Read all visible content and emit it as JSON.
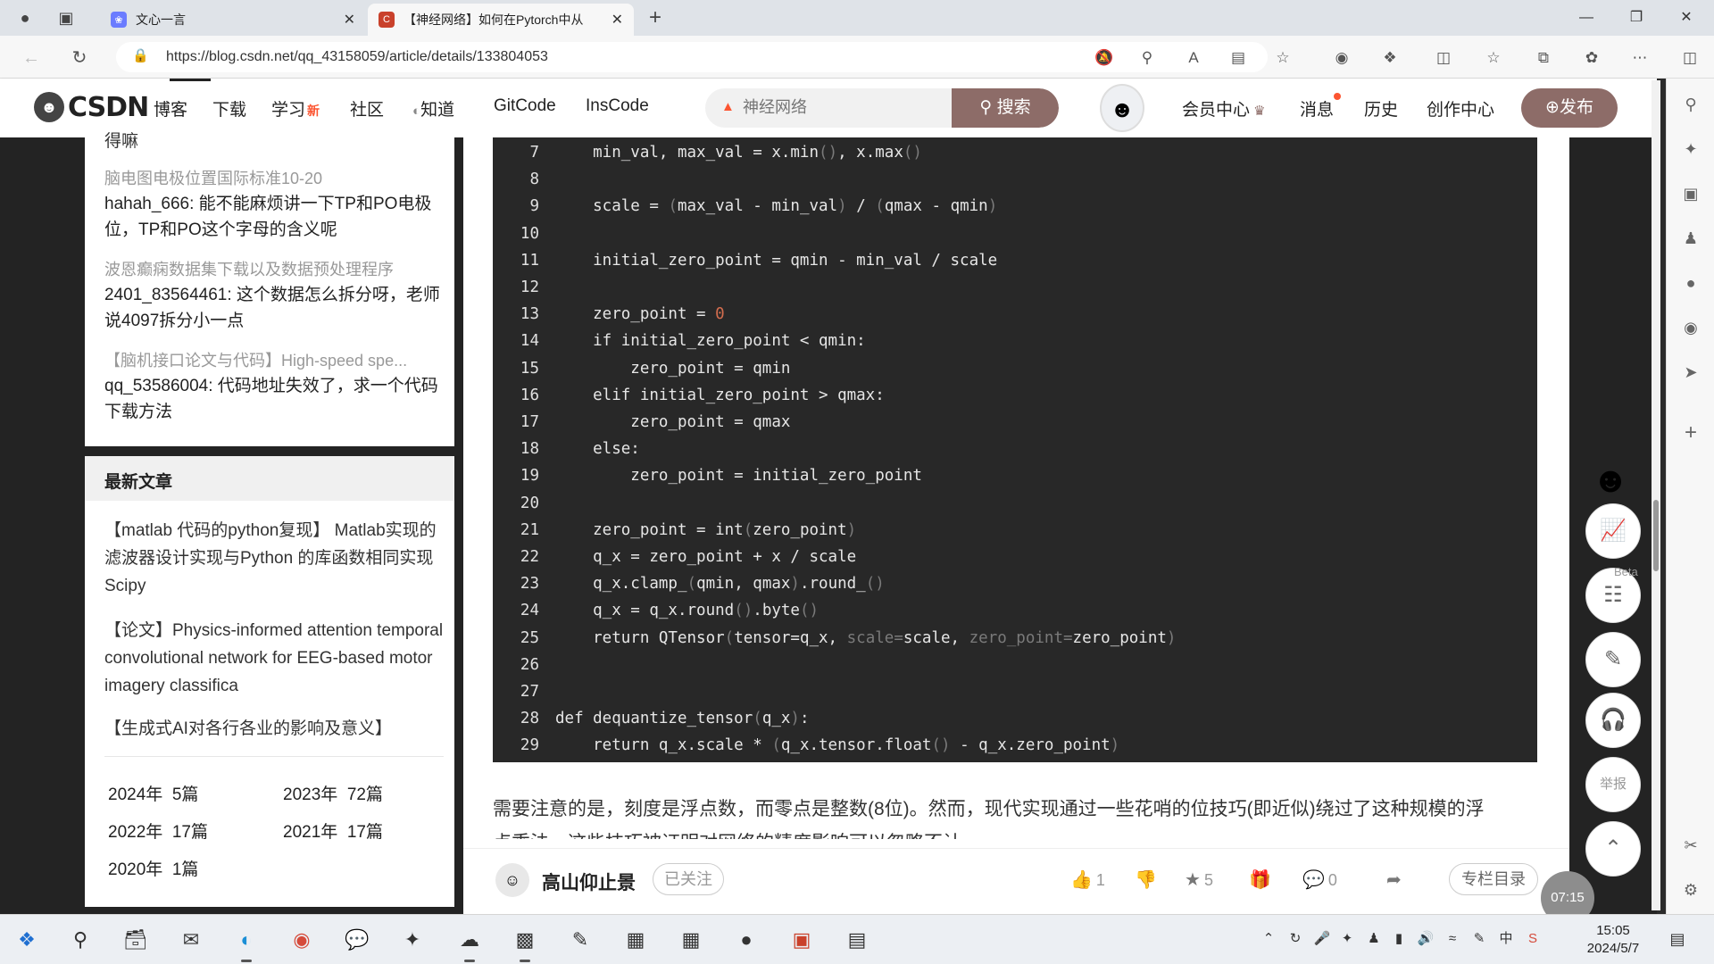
{
  "browser": {
    "tabs": [
      {
        "title": "文心一言",
        "active": false
      },
      {
        "title": "【神经网络】如何在Pytorch中从",
        "active": true
      }
    ],
    "url": "https://blog.csdn.net/qq_43158059/article/details/133804053"
  },
  "header": {
    "logo": "CSDN",
    "nav": [
      {
        "label": "博客"
      },
      {
        "label": "下载"
      },
      {
        "label": "学习",
        "badge": "新"
      },
      {
        "label": "社区"
      },
      {
        "label": "知道"
      },
      {
        "label": "GitCode"
      },
      {
        "label": "InsCode"
      }
    ],
    "search": {
      "placeholder": "神经网络",
      "button": "搜索"
    },
    "right_nav": [
      "会员中心",
      "消息",
      "历史",
      "创作中心"
    ],
    "publish": "发布"
  },
  "sidebar": {
    "comments_partial_top": "得嘛",
    "comments": [
      {
        "source": "脑电图电极位置国际标准10-20",
        "text": "hahah_666: 能不能麻烦讲一下TP和PO电极位，TP和PO这个字母的含义呢"
      },
      {
        "source": "波恩癫痫数据集下载以及数据预处理程序",
        "text": "2401_83564461: 这个数据怎么拆分呀，老师说4097拆分小一点"
      },
      {
        "source": "【脑机接口论文与代码】High-speed spe...",
        "text": "qq_53586004: 代码地址失效了，求一个代码下载方法"
      }
    ],
    "recent_title": "最新文章",
    "recent_articles": [
      "【matlab 代码的python复现】 Matlab实现的滤波器设计实现与Python 的库函数相同实现Scipy",
      "【论文】Physics-informed attention temporal convolutional network for EEG-based motor imagery classifica",
      "【生成式AI对各行各业的影响及意义】"
    ],
    "archive": [
      {
        "year": "2024年",
        "count": "5篇"
      },
      {
        "year": "2023年",
        "count": "72篇"
      },
      {
        "year": "2022年",
        "count": "17篇"
      },
      {
        "year": "2021年",
        "count": "17篇"
      },
      {
        "year": "2020年",
        "count": "1篇"
      }
    ]
  },
  "code": {
    "lines": [
      {
        "n": "7",
        "src": "    min_val, max_val = x.min(), x.max()"
      },
      {
        "n": "8",
        "src": ""
      },
      {
        "n": "9",
        "src": "    scale = (max_val - min_val) / (qmax - qmin)"
      },
      {
        "n": "10",
        "src": ""
      },
      {
        "n": "11",
        "src": "    initial_zero_point = qmin - min_val / scale"
      },
      {
        "n": "12",
        "src": ""
      },
      {
        "n": "13",
        "src": "    zero_point = 0"
      },
      {
        "n": "14",
        "src": "    if initial_zero_point < qmin:"
      },
      {
        "n": "15",
        "src": "        zero_point = qmin"
      },
      {
        "n": "16",
        "src": "    elif initial_zero_point > qmax:"
      },
      {
        "n": "17",
        "src": "        zero_point = qmax"
      },
      {
        "n": "18",
        "src": "    else:"
      },
      {
        "n": "19",
        "src": "        zero_point = initial_zero_point"
      },
      {
        "n": "20",
        "src": ""
      },
      {
        "n": "21",
        "src": "    zero_point = int(zero_point)"
      },
      {
        "n": "22",
        "src": "    q_x = zero_point + x / scale"
      },
      {
        "n": "23",
        "src": "    q_x.clamp_(qmin, qmax).round_()"
      },
      {
        "n": "24",
        "src": "    q_x = q_x.round().byte()"
      },
      {
        "n": "25",
        "src": "    return QTensor(tensor=q_x, scale=scale, zero_point=zero_point)"
      },
      {
        "n": "26",
        "src": ""
      },
      {
        "n": "27",
        "src": ""
      },
      {
        "n": "28",
        "src": "def dequantize_tensor(q_x):"
      },
      {
        "n": "29",
        "src": "    return q_x.scale * (q_x.tensor.float() - q_x.zero_point)"
      }
    ]
  },
  "article": {
    "paragraph": "需要注意的是，刻度是浮点数，而零点是整数(8位)。然而，现代实现通过一些花哨的位技巧(即近似)绕过了这种规模的浮",
    "paragraph_cut": "点乘法，这些技巧被证明对网络的精度影响可以忽略不计。"
  },
  "bottom_bar": {
    "author": "高山仰止景",
    "follow": "已关注",
    "likes": "1",
    "favorites": "5",
    "comments": "0",
    "toc": "专栏目录"
  },
  "floating": {
    "beta": "Beta",
    "report": "举报",
    "timer": "07:15"
  },
  "taskbar": {
    "time": "15:05",
    "date": "2024/5/7",
    "ime": "中"
  }
}
